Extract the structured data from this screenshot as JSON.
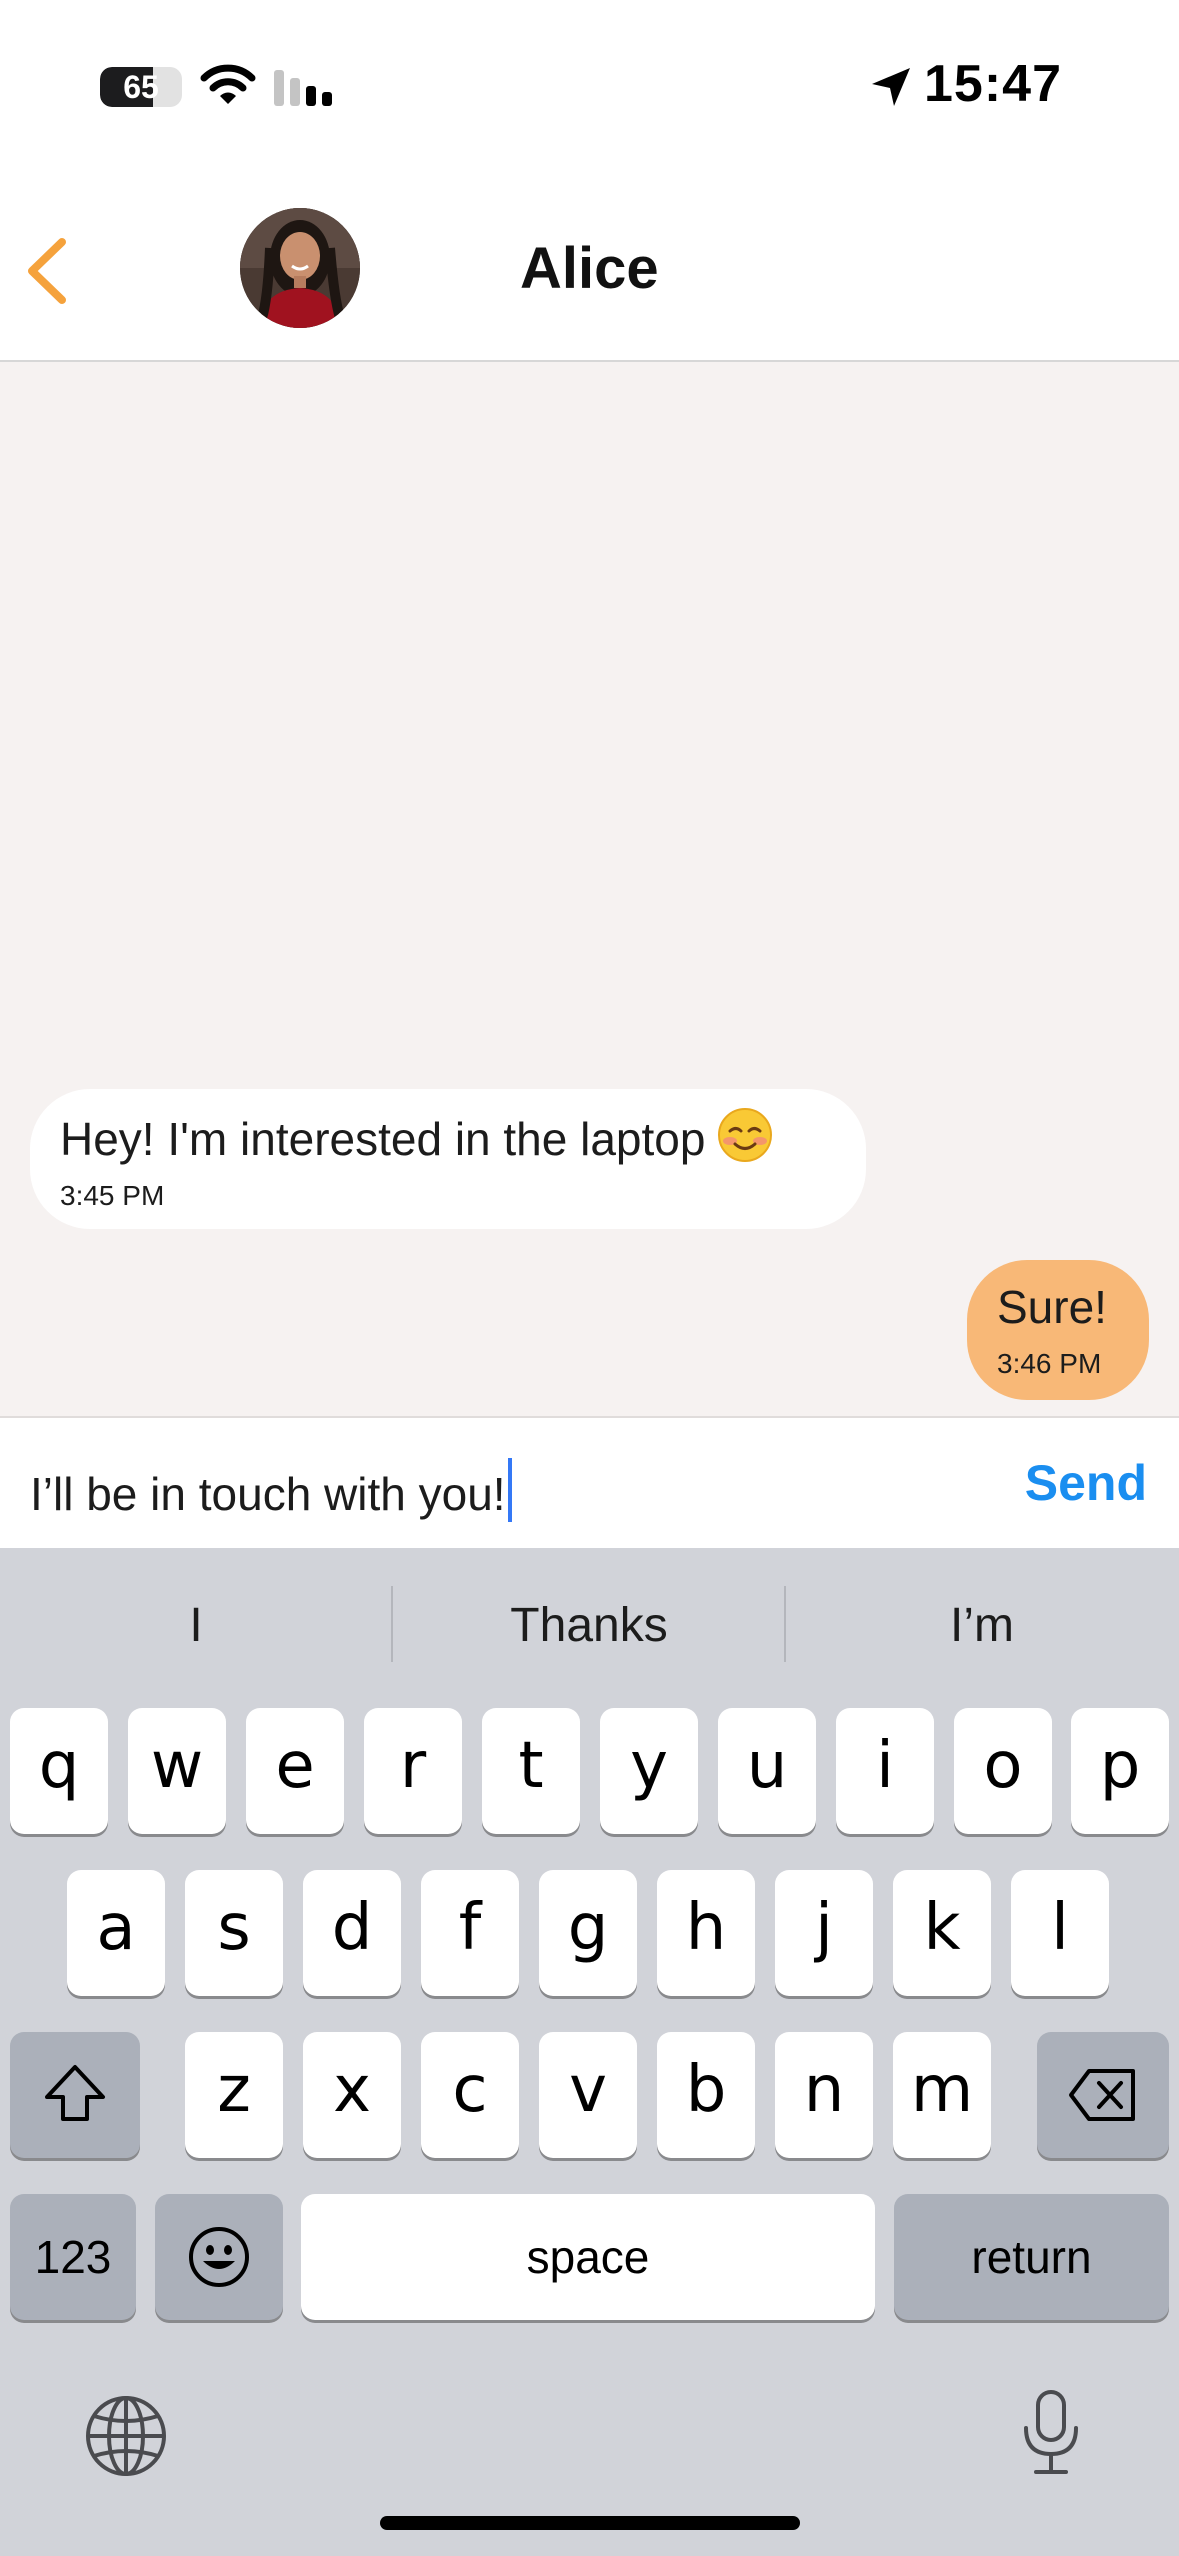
{
  "status_bar": {
    "battery_percent": 65,
    "battery_label": "65",
    "time": "15:47",
    "icons": [
      "wifi-icon",
      "cellular-signal-icon",
      "location-arrow-icon"
    ]
  },
  "header": {
    "contact_name": "Alice",
    "back_icon": "chevron-left-icon",
    "accent_color": "#F5A23C"
  },
  "messages": [
    {
      "direction": "incoming",
      "text": "Hey! I'm interested in the laptop",
      "emoji": "☺️",
      "time": "3:45 PM"
    },
    {
      "direction": "outgoing",
      "text": "Sure!",
      "time": "3:46 PM"
    }
  ],
  "composer": {
    "value": "I’ll be in touch with you!",
    "send_label": "Send",
    "send_color": "#1A8EF0"
  },
  "keyboard": {
    "suggestions": [
      "I",
      "Thanks",
      "I’m"
    ],
    "rows": [
      [
        "q",
        "w",
        "e",
        "r",
        "t",
        "y",
        "u",
        "i",
        "o",
        "p"
      ],
      [
        "a",
        "s",
        "d",
        "f",
        "g",
        "h",
        "j",
        "k",
        "l"
      ],
      [
        "z",
        "x",
        "c",
        "v",
        "b",
        "n",
        "m"
      ]
    ],
    "numbers_label": "123",
    "space_label": "space",
    "return_label": "return",
    "icons": [
      "shift-icon",
      "delete-icon",
      "emoji-icon",
      "globe-icon",
      "microphone-icon"
    ]
  },
  "colors": {
    "chat_background": "#F6F2F1",
    "outgoing_bubble": "#F8B877",
    "incoming_bubble": "#FFFFFF",
    "keyboard_background": "#D1D3D9"
  }
}
